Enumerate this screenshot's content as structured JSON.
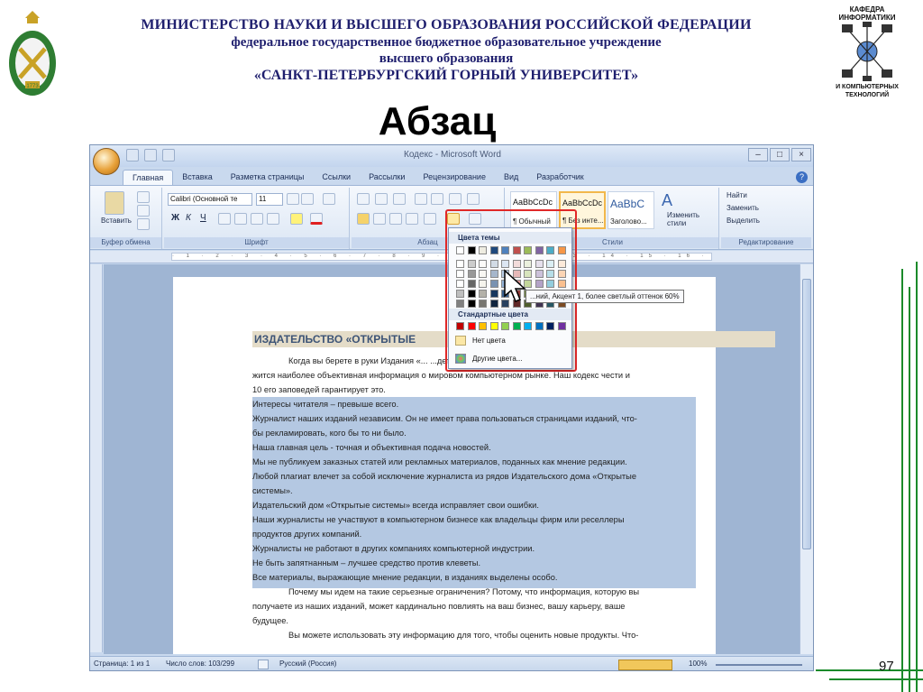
{
  "header": {
    "line1": "МИНИСТЕРСТВО НАУКИ И ВЫСШЕГО ОБРАЗОВАНИЯ РОССИЙСКОЙ ФЕДЕРАЦИИ",
    "line2": "федеральное государственное бюджетное образовательное учреждение",
    "line3": "высшего образования",
    "line4": "«САНКТ-ПЕТЕРБУРГСКИЙ ГОРНЫЙ УНИВЕРСИТЕТ»",
    "dept_top": "КАФЕДРА ИНФОРМАТИКИ",
    "dept_bottom": "И КОМПЬЮТЕРНЫХ ТЕХНОЛОГИЙ",
    "logo_year": "1773"
  },
  "slide_title": "Абзац",
  "slide_number": "97",
  "word": {
    "window_title": "Кодекс - Microsoft Word",
    "tabs": [
      "Главная",
      "Вставка",
      "Разметка страницы",
      "Ссылки",
      "Рассылки",
      "Рецензирование",
      "Вид",
      "Разработчик"
    ],
    "ribbon": {
      "paste_label": "Вставить",
      "font_name": "Calibri (Основной те",
      "font_size": "11",
      "styles": [
        {
          "sample": "AaBbCcDc",
          "name": "¶ Обычный"
        },
        {
          "sample": "AaBbCcDc",
          "name": "¶ Без инте..."
        },
        {
          "sample": "AaBbC",
          "name": "Заголово..."
        }
      ],
      "change_styles": "Изменить стили",
      "find": "Найти",
      "replace": "Заменить",
      "select": "Выделить",
      "groups": [
        "Буфер обмена",
        "Шрифт",
        "Абзац",
        "Стили",
        "Редактирование"
      ]
    },
    "color_menu": {
      "theme_header": "Цвета темы",
      "standard_header": "Стандартные цвета",
      "no_color": "Нет цвета",
      "more_colors": "Другие цвета...",
      "tooltip": "...ний, Акцент 1, более светлый оттенок 60%",
      "theme_colors": [
        "#ffffff",
        "#000000",
        "#eeece1",
        "#1f497d",
        "#4f81bd",
        "#c0504d",
        "#9bbb59",
        "#8064a2",
        "#4bacc6",
        "#f79646"
      ],
      "standard_colors": [
        "#c00000",
        "#ff0000",
        "#ffc000",
        "#ffff00",
        "#92d050",
        "#00b050",
        "#00b0f0",
        "#0070c0",
        "#002060",
        "#7030a0"
      ]
    },
    "document": {
      "heading": "ИЗДАТЕЛЬСТВО «ОТКРЫТЫЕ",
      "lines": [
        "Когда вы берете в руки Издания «...                  ...дете знать, что в них содер-",
        "жится наиболее объективная информация о мировом компьютерном рынке. Наш кодекс чести и",
        "10 его заповедей гарантирует это.",
        "Интересы читателя – превыше всего.",
        "Журналист наших изданий независим. Он не имеет права пользоваться страницами изданий, что-",
        "бы рекламировать, кого бы то ни было.",
        "Наша главная цель - точная и объективная подача новостей.",
        "Мы не публикуем заказных статей или рекламных материалов, поданных как мнение редакции.",
        "Любой плагиат влечет за собой исключение журналиста из рядов Издательского дома «Открытые",
        "системы».",
        "Издательский дом «Открытые системы» всегда исправляет свои ошибки.",
        "Наши журналисты не участвуют в компьютерном бизнесе как владельцы фирм или реселлеры",
        "продуктов других компаний.",
        "Журналисты не работают в других компаниях компьютерной индустрии.",
        "Не быть запятнанным – лучшее средство против клеветы.",
        "Все материалы, выражающие мнение редакции, в изданиях выделены особо.",
        "Почему мы идем на такие серьезные ограничения? Потому, что информация, которую вы",
        "получаете из наших изданий, может кардинально повлиять на ваш бизнес, вашу карьеру, ваше",
        "будущее.",
        "Вы можете использовать эту информацию для того, чтобы оценить новые продукты. Что-"
      ]
    },
    "status": {
      "page": "Страница: 1 из 1",
      "words": "Число слов: 103/299",
      "language": "Русский (Россия)",
      "zoom": "100%"
    }
  }
}
